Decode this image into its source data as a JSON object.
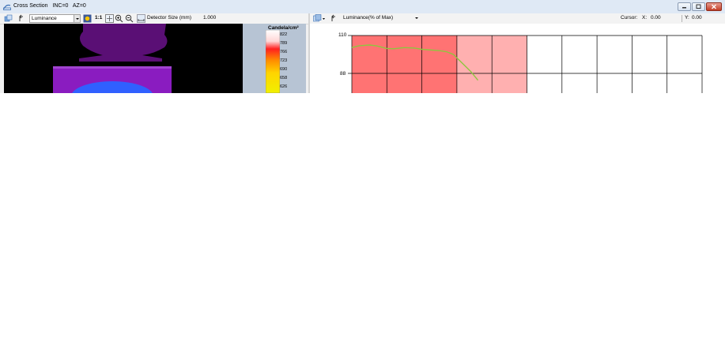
{
  "window": {
    "title": "Cross Section   INC=0   AZ=0"
  },
  "left_toolbar": {
    "icons": [
      "export-icon",
      "undo-icon",
      "display-icon",
      "one-to-one-icon",
      "fit-icon",
      "zoom-in-icon",
      "zoom-out-icon",
      "detector-size-icon"
    ],
    "view_select": "Luminance",
    "one_to_one_label": "1:1",
    "detector_size_label": "Detector Size (mm)",
    "detector_size_value": "1.000"
  },
  "legend": {
    "title": "Candela/cm²",
    "ticks": [
      "822",
      "789",
      "766",
      "723",
      "690",
      "658",
      "626"
    ],
    "colors": [
      "#ffffff",
      "#ffd0d0",
      "#ff3030",
      "#ff8000",
      "#ffd000",
      "#ffff20",
      "#e0e000"
    ]
  },
  "right_toolbar": {
    "icons": [
      "copy-dropdown-icon",
      "undo-icon"
    ],
    "mode_select": "Luminance(% of Max)",
    "cursor_label": "Cursor:",
    "x_label": "X:",
    "x_value": "0.00",
    "y_label": "Y:",
    "y_value": "0.00"
  },
  "chart_data": {
    "type": "line",
    "ylim_visible": [
      110,
      88
    ],
    "y_tick_labels": [
      "110",
      "88"
    ],
    "grid": true,
    "series": [
      {
        "color": "#8ec63f",
        "points_x_fraction": [
          0.0,
          0.02,
          0.05,
          0.07,
          0.1,
          0.12,
          0.15,
          0.18,
          0.2,
          0.23,
          0.25,
          0.27,
          0.29,
          0.3,
          0.32,
          0.34,
          0.36
        ],
        "values": [
          103,
          104,
          104.5,
          104,
          102.5,
          102.3,
          103,
          102.7,
          102,
          101.5,
          101.2,
          100.6,
          99,
          97,
          93,
          89,
          84
        ]
      }
    ],
    "shaded_bands": [
      {
        "x_from_fraction": 0.0,
        "x_to_fraction": 0.3,
        "color": "#ff7373"
      },
      {
        "x_from_fraction": 0.3,
        "x_to_fraction": 0.5,
        "color": "#ffb0b0"
      }
    ]
  }
}
